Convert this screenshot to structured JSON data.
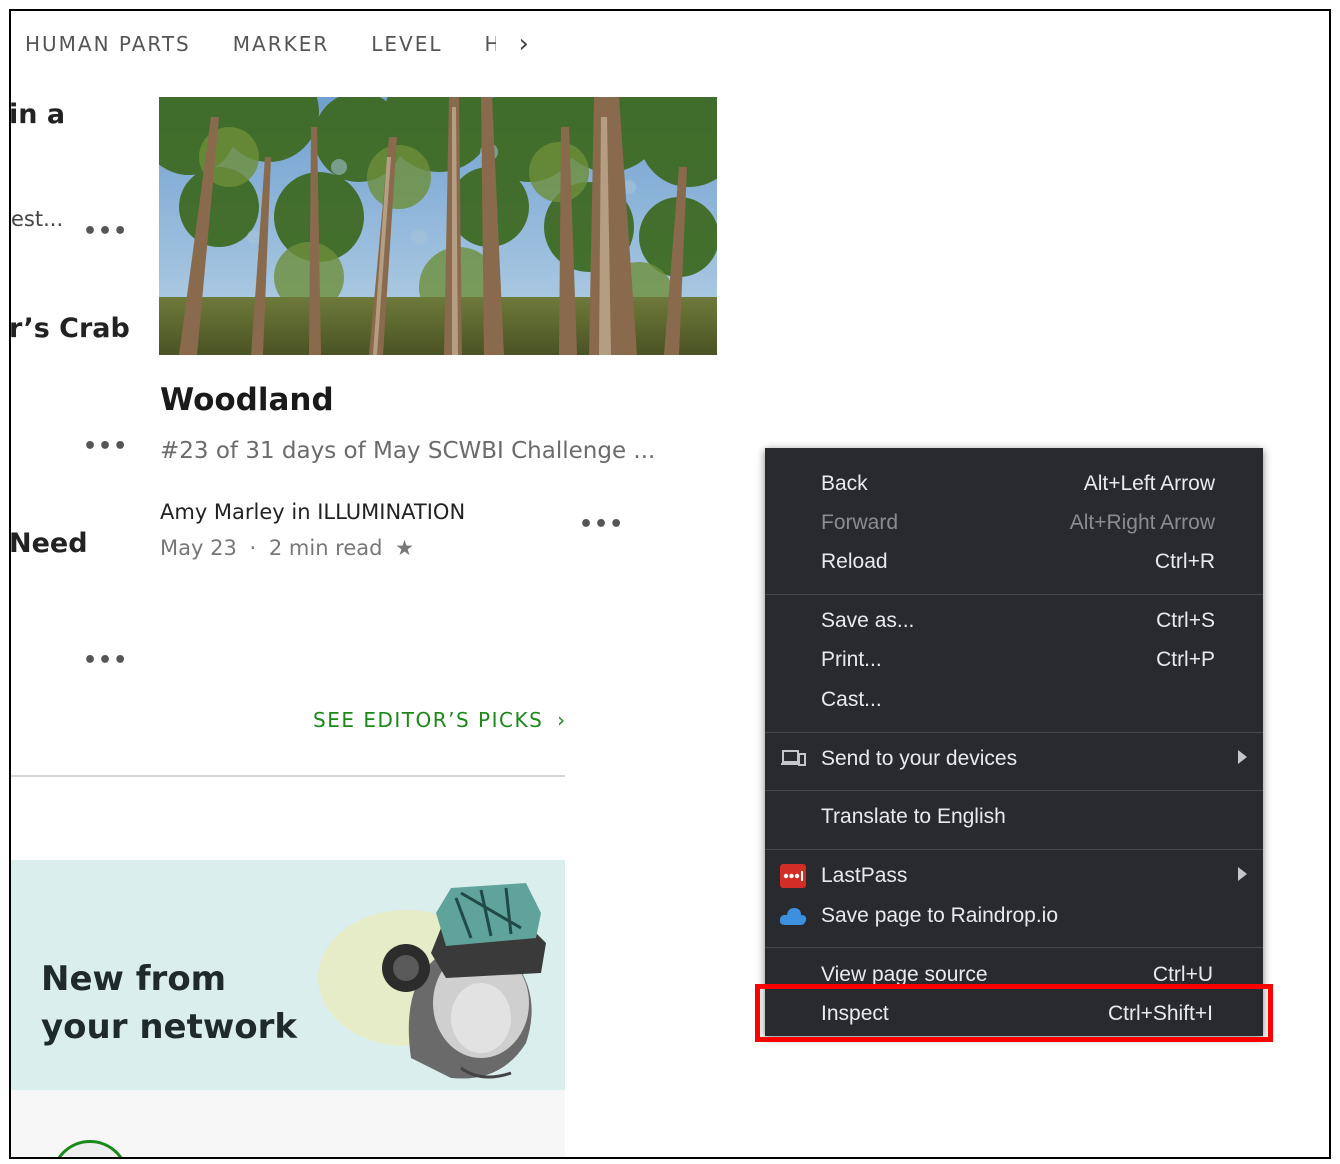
{
  "topnav": {
    "items": [
      "HUMAN PARTS",
      "MARKER",
      "LEVEL",
      "H"
    ],
    "next_arrow": "›"
  },
  "left_column": {
    "fragment1": "in a",
    "fragment2": "est...",
    "fragment3": "r’s Crab",
    "fragment4": "Need",
    "more": "•••"
  },
  "article": {
    "title": "Woodland",
    "subtitle": "#23 of 31 days of May SCWBI Challenge ...",
    "author": "Amy Marley in ILLUMINATION",
    "date": "May 23",
    "separator": "·",
    "read_time": "2 min read",
    "star": "★",
    "more": "•••"
  },
  "editors_picks": {
    "label": "SEE EDITOR’S PICKS",
    "arrow": "›"
  },
  "banner": {
    "line1": "New from",
    "line2": "your network"
  },
  "context_menu": {
    "items": [
      {
        "label": "Back",
        "shortcut": "Alt+Left Arrow"
      },
      {
        "label": "Forward",
        "shortcut": "Alt+Right Arrow"
      },
      {
        "label": "Reload",
        "shortcut": "Ctrl+R"
      },
      {
        "label": "Save as...",
        "shortcut": "Ctrl+S"
      },
      {
        "label": "Print...",
        "shortcut": "Ctrl+P"
      },
      {
        "label": "Cast...",
        "shortcut": ""
      },
      {
        "label": "Send to your devices",
        "shortcut": "",
        "icon": "devices-icon"
      },
      {
        "label": "Translate to English",
        "shortcut": ""
      },
      {
        "label": "LastPass",
        "shortcut": "",
        "icon": "lastpass-icon"
      },
      {
        "label": "Save page to Raindrop.io",
        "shortcut": "",
        "icon": "raindrop-cloud-icon"
      },
      {
        "label": "View page source",
        "shortcut": "Ctrl+U"
      },
      {
        "label": "Inspect",
        "shortcut": "Ctrl+Shift+I"
      }
    ],
    "highlight_color": "#ff0000",
    "background": "#292a2d"
  },
  "colors": {
    "accent_green": "#1a8917",
    "banner_bg": "#dbeeee"
  }
}
